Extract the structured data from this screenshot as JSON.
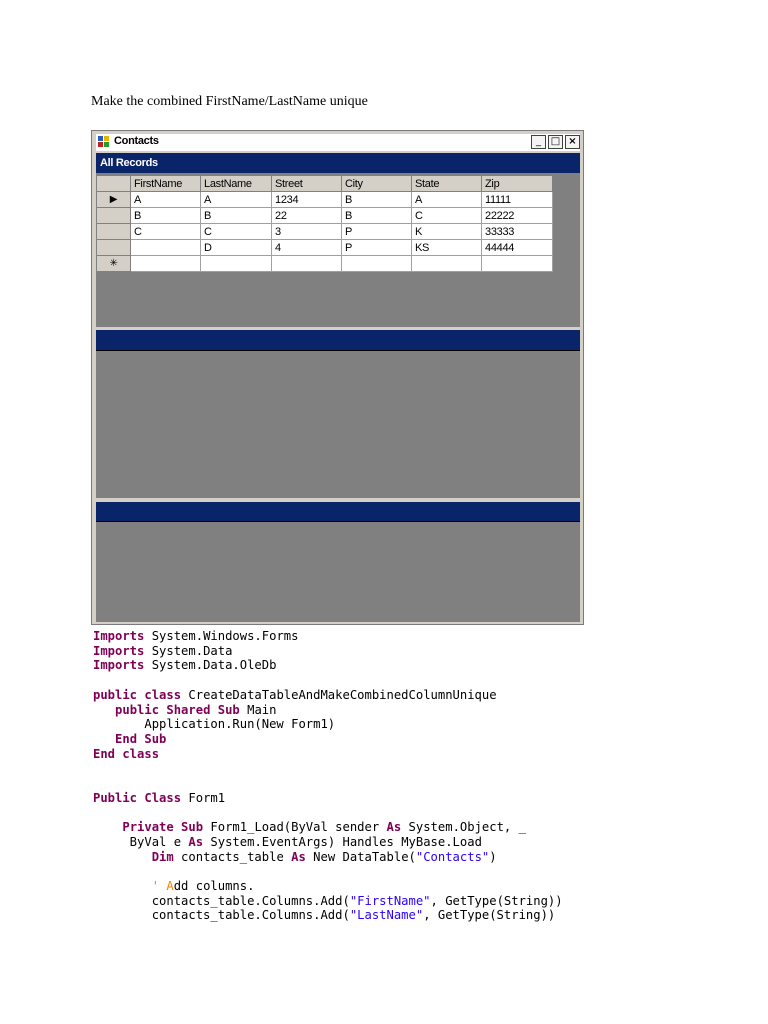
{
  "heading": "Make the combined FirstName/LastName unique",
  "window": {
    "title": "Contacts",
    "controls": {
      "minimize": "_",
      "maximize": "□",
      "close": "×"
    },
    "icon": "app-icon"
  },
  "panes": {
    "top": {
      "title": "All Records"
    },
    "middle": {
      "title": ""
    },
    "bottom": {
      "title": ""
    }
  },
  "grid": {
    "columns": [
      "FirstName",
      "LastName",
      "Street",
      "City",
      "State",
      "Zip"
    ],
    "rows": [
      {
        "indicator": "▶",
        "cells": [
          "A",
          "A",
          "1234",
          "B",
          "A",
          "11111"
        ]
      },
      {
        "indicator": "",
        "cells": [
          "B",
          "B",
          "22",
          "B",
          "C",
          "22222"
        ]
      },
      {
        "indicator": "",
        "cells": [
          "C",
          "C",
          "3",
          "P",
          "K",
          "33333"
        ]
      },
      {
        "indicator": "",
        "cells": [
          "",
          "D",
          "4",
          "P",
          "KS",
          "44444"
        ]
      },
      {
        "indicator": "✳",
        "cells": [
          "",
          "",
          "",
          "",
          "",
          ""
        ]
      }
    ]
  },
  "code": {
    "colors": {
      "keyword": "#7f0055",
      "string": "#2a00ff",
      "comment": "#ff8000"
    },
    "lines": [
      [
        {
          "t": "kw",
          "v": "Imports"
        },
        {
          "t": "tx",
          "v": " System.Windows.Forms"
        }
      ],
      [
        {
          "t": "kw",
          "v": "Imports"
        },
        {
          "t": "tx",
          "v": " System.Data"
        }
      ],
      [
        {
          "t": "kw",
          "v": "Imports"
        },
        {
          "t": "tx",
          "v": " System.Data.OleDb"
        }
      ],
      [],
      [
        {
          "t": "kw",
          "v": "public class"
        },
        {
          "t": "tx",
          "v": " CreateDataTableAndMakeCombinedColumnUnique"
        }
      ],
      [
        {
          "t": "tx",
          "v": "   "
        },
        {
          "t": "kw",
          "v": "public Shared Sub"
        },
        {
          "t": "tx",
          "v": " Main"
        }
      ],
      [
        {
          "t": "tx",
          "v": "       Application.Run(New Form1)"
        }
      ],
      [
        {
          "t": "tx",
          "v": "   "
        },
        {
          "t": "kw",
          "v": "End Sub"
        }
      ],
      [
        {
          "t": "kw",
          "v": "End class"
        }
      ],
      [],
      [],
      [
        {
          "t": "kw",
          "v": "Public Class"
        },
        {
          "t": "tx",
          "v": " Form1"
        }
      ],
      [],
      [
        {
          "t": "tx",
          "v": "    "
        },
        {
          "t": "kw",
          "v": "Private Sub"
        },
        {
          "t": "tx",
          "v": " Form1_Load(ByVal sender "
        },
        {
          "t": "kw",
          "v": "As"
        },
        {
          "t": "tx",
          "v": " System.Object, _"
        }
      ],
      [
        {
          "t": "tx",
          "v": "     ByVal e "
        },
        {
          "t": "kw",
          "v": "As"
        },
        {
          "t": "tx",
          "v": " System.EventArgs) Handles MyBase.Load"
        }
      ],
      [
        {
          "t": "tx",
          "v": "        "
        },
        {
          "t": "kw",
          "v": "Dim"
        },
        {
          "t": "tx",
          "v": " contacts_table "
        },
        {
          "t": "kw",
          "v": "As"
        },
        {
          "t": "tx",
          "v": " New DataTable("
        },
        {
          "t": "str",
          "v": "\"Contacts\""
        },
        {
          "t": "tx",
          "v": ")"
        }
      ],
      [],
      [
        {
          "t": "tx",
          "v": "        "
        },
        {
          "t": "cm",
          "v": "' A"
        },
        {
          "t": "tx",
          "v": "dd columns."
        }
      ],
      [
        {
          "t": "tx",
          "v": "        contacts_table.Columns.Add("
        },
        {
          "t": "str",
          "v": "\"FirstName\""
        },
        {
          "t": "tx",
          "v": ", GetType(String))"
        }
      ],
      [
        {
          "t": "tx",
          "v": "        contacts_table.Columns.Add("
        },
        {
          "t": "str",
          "v": "\"LastName\""
        },
        {
          "t": "tx",
          "v": ", GetType(String))"
        }
      ]
    ]
  }
}
